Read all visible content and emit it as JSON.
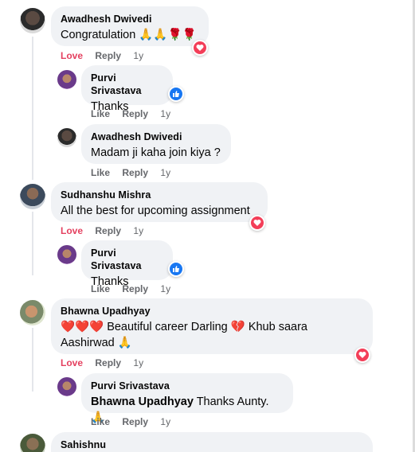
{
  "comments": [
    {
      "author": "Awadhesh Dwivedi",
      "text": "Congratulation 🙏🙏🌹🌹",
      "actions": [
        "Love",
        "Reply",
        "1y"
      ],
      "reaction": "love"
    },
    {
      "author": "Purvi Srivastava",
      "text": "Thanks",
      "actions": [
        "Like",
        "Reply",
        "1y"
      ],
      "reaction": "like"
    },
    {
      "author": "Awadhesh Dwivedi",
      "text": "Madam ji kaha join kiya ?",
      "actions": [
        "Like",
        "Reply",
        "1y"
      ]
    },
    {
      "author": "Sudhanshu Mishra",
      "text": "All the best for upcoming assignment",
      "actions": [
        "Love",
        "Reply",
        "1y"
      ],
      "reaction": "love"
    },
    {
      "author": "Purvi Srivastava",
      "text": "Thanks",
      "actions": [
        "Like",
        "Reply",
        "1y"
      ],
      "reaction": "like"
    },
    {
      "author": "Bhawna Upadhyay",
      "text_line1": "❤️❤️❤️ Beautiful career Darling 💔 Khub saara",
      "text_line2": "Aashirwad 🙏",
      "actions": [
        "Love",
        "Reply",
        "1y"
      ],
      "reaction": "love"
    },
    {
      "author": "Purvi Srivastava",
      "mention": "Bhawna Upadhyay",
      "text": " Thanks Aunty. 🙏",
      "actions": [
        "Like",
        "Reply",
        "1y"
      ]
    },
    {
      "author": "Sahishnu"
    }
  ],
  "colors": {
    "bubble": "#f0f2f5",
    "love": "#e4405f",
    "like": "#1877f2",
    "meta": "#65676b"
  }
}
